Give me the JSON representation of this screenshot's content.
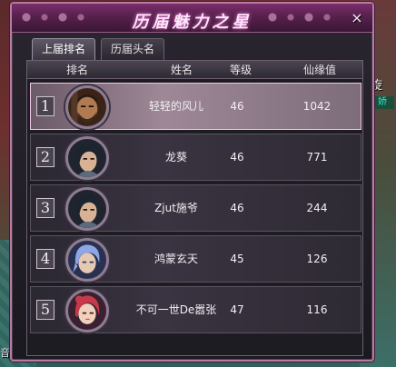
{
  "window": {
    "title": "历届魅力之星",
    "close_symbol": "×"
  },
  "tabs": [
    {
      "label": "上届排名",
      "active": true
    },
    {
      "label": "历届头名",
      "active": false
    }
  ],
  "table": {
    "headers": {
      "rank": "排名",
      "name": "姓名",
      "level": "等级",
      "charm": "仙缘值"
    },
    "rows": [
      {
        "rank": "1",
        "name": "轻轻的风儿",
        "level": "46",
        "charm": "1042",
        "avatar": "avatar-bearded-warrior-icon",
        "selected": true
      },
      {
        "rank": "2",
        "name": "龙葵",
        "level": "46",
        "charm": "771",
        "avatar": "avatar-dark-haired-male-icon",
        "selected": false
      },
      {
        "rank": "3",
        "name": "Zjut施爷",
        "level": "46",
        "charm": "244",
        "avatar": "avatar-dark-haired-male-icon",
        "selected": false
      },
      {
        "rank": "4",
        "name": "鸿蒙玄天",
        "level": "45",
        "charm": "126",
        "avatar": "avatar-blue-haired-youth-icon",
        "selected": false
      },
      {
        "rank": "5",
        "name": "不可一世De嚣张",
        "level": "47",
        "charm": "116",
        "avatar": "avatar-red-haired-female-icon",
        "selected": false
      }
    ]
  },
  "background": {
    "side_text": "旋",
    "side_badge": "娇",
    "bottom_text": "音"
  },
  "colors": {
    "title_bar": "#57214d",
    "frame": "#b97aa6",
    "selected_row": "#9e8898"
  }
}
